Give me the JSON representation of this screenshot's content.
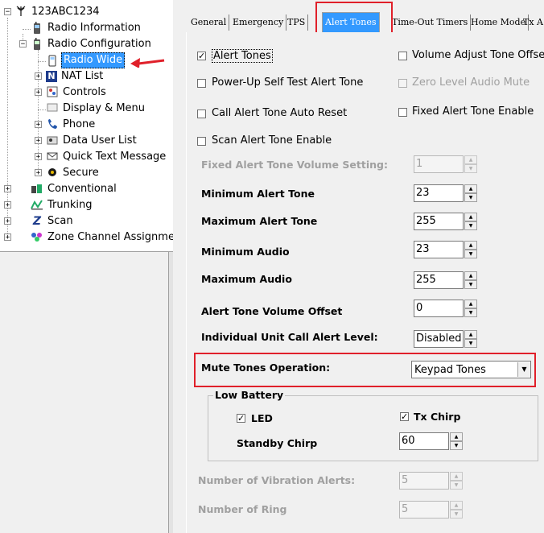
{
  "tree": {
    "root": "123ABC1234",
    "items": [
      {
        "label": "Radio Information",
        "icon": "radio-info-icon"
      },
      {
        "label": "Radio Configuration",
        "icon": "radio-config-icon"
      },
      {
        "label": "Radio Wide",
        "icon": "radio-icon",
        "selected": true
      },
      {
        "label": "NAT List",
        "icon": "nat-icon"
      },
      {
        "label": "Controls",
        "icon": "controls-icon"
      },
      {
        "label": "Display & Menu",
        "icon": "display-icon"
      },
      {
        "label": "Phone",
        "icon": "phone-icon"
      },
      {
        "label": "Data User List",
        "icon": "data-user-icon"
      },
      {
        "label": "Quick Text Message",
        "icon": "message-icon"
      },
      {
        "label": "Secure",
        "icon": "secure-icon"
      },
      {
        "label": "Conventional",
        "icon": "conventional-icon"
      },
      {
        "label": "Trunking",
        "icon": "trunking-icon"
      },
      {
        "label": "Scan",
        "icon": "scan-icon"
      },
      {
        "label": "Zone Channel Assignment",
        "icon": "zone-icon"
      }
    ]
  },
  "tabs": [
    "General",
    "Emergency",
    "TPS",
    "Alert Tones",
    "Time-Out Timers",
    "Home Mode",
    "Tx A"
  ],
  "active_tab": "Alert Tones",
  "checkboxes": {
    "alert_tones": {
      "label": "Alert Tones",
      "checked": true
    },
    "volume_adjust": {
      "label": "Volume Adjust Tone Offse",
      "checked": false
    },
    "power_up": {
      "label": "Power-Up Self Test Alert Tone",
      "checked": false
    },
    "zero_level": {
      "label": "Zero Level Audio Mute",
      "checked": false
    },
    "call_alert_reset": {
      "label": "Call Alert Tone Auto Reset",
      "checked": false
    },
    "fixed_alert": {
      "label": "Fixed Alert Tone Enable",
      "checked": false
    },
    "scan_alert": {
      "label": "Scan Alert Tone Enable",
      "checked": false
    }
  },
  "fields": {
    "fixed_volume": {
      "label": "Fixed Alert Tone Volume Setting:",
      "value": "1"
    },
    "min_alert": {
      "label": "Minimum Alert Tone",
      "value": "23"
    },
    "max_alert": {
      "label": "Maximum Alert Tone",
      "value": "255"
    },
    "min_audio": {
      "label": "Minimum Audio",
      "value": "23"
    },
    "max_audio": {
      "label": "Maximum Audio",
      "value": "255"
    },
    "volume_offset": {
      "label": "Alert Tone Volume Offset",
      "value": "0"
    },
    "unit_call_level": {
      "label": "Individual Unit Call Alert Level:",
      "value": "Disabled"
    },
    "mute_tones": {
      "label": "Mute Tones Operation:",
      "value": "Keypad Tones"
    }
  },
  "low_battery": {
    "title": "Low Battery",
    "led": {
      "label": "LED",
      "checked": true
    },
    "tx_chirp": {
      "label": "Tx Chirp",
      "checked": true
    },
    "standby_chirp": {
      "label": "Standby Chirp",
      "value": "60"
    }
  },
  "vibration": {
    "label": "Number of Vibration Alerts:",
    "value": "5"
  },
  "ring": {
    "label": "Number of Ring",
    "value": "5"
  },
  "check_glyph": "✓",
  "colors": {
    "selection": "#3399ff",
    "annotation": "#e0202a"
  }
}
